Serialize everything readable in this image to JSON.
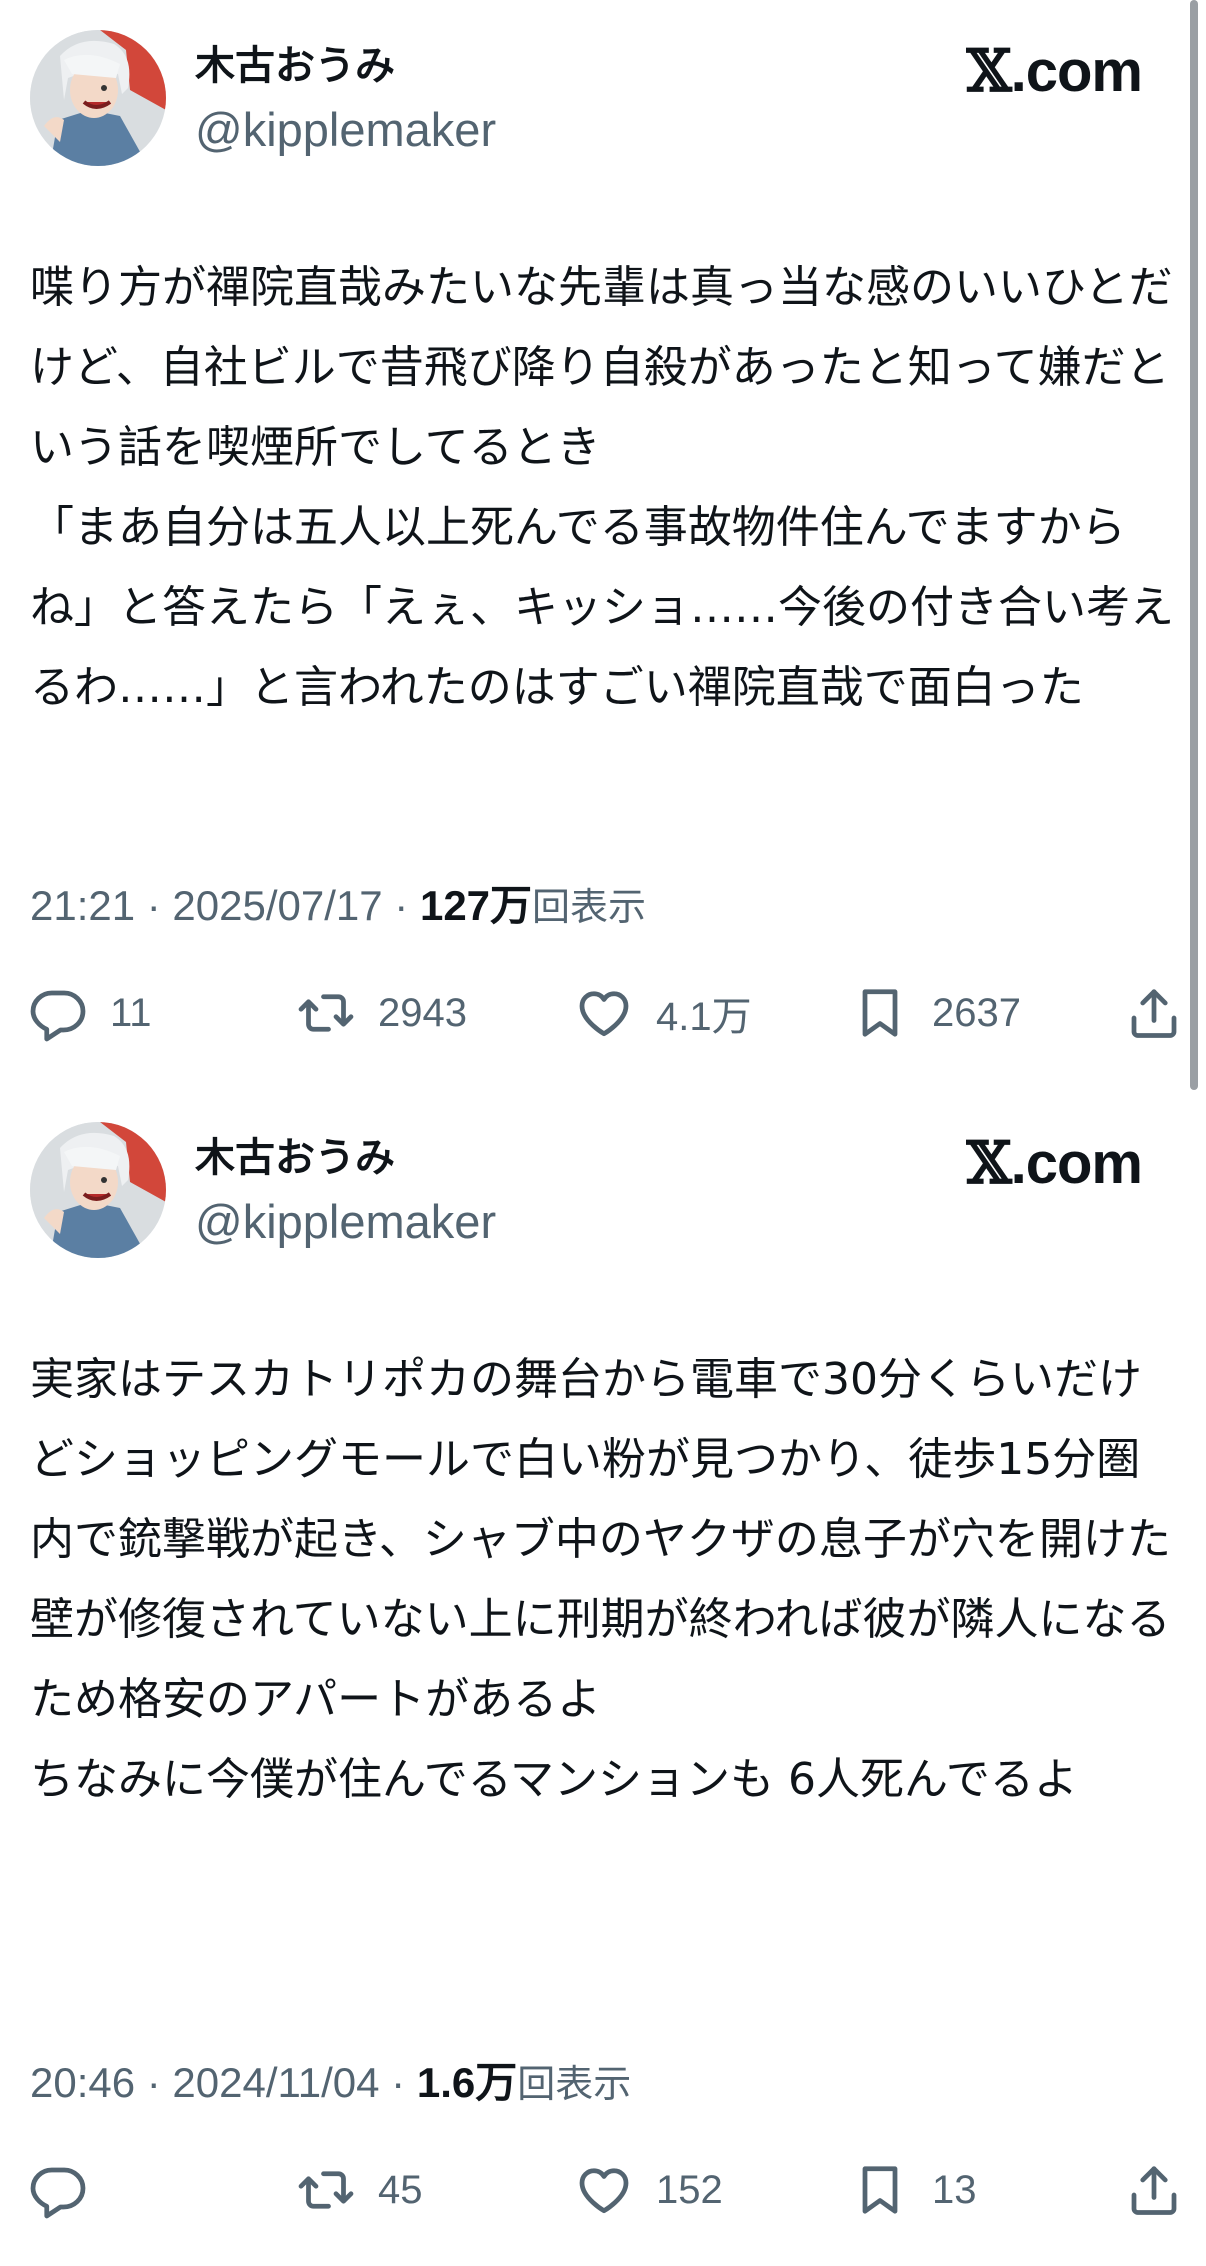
{
  "tweets": [
    {
      "author": {
        "display_name": "木古おうみ",
        "handle": "@kipplemaker"
      },
      "brand": ".com",
      "text": "喋り方が禪院直哉みたいな先輩は真っ当な感のいいひとだけど、自社ビルで昔飛び降り自殺があったと知って嫌だという話を喫煙所でしてるとき\n「まあ自分は五人以上死んでる事故物件住んでますからね」と答えたら「えぇ、キッショ……今後の付き合い考えるわ……」と言われたのはすごい禪院直哉で面白った",
      "timestamp": "21:21 · 2025/07/17 · ",
      "views_count": "127万",
      "views_label": "回表示",
      "actions": {
        "replies": "11",
        "reposts": "2943",
        "likes": "4.1万",
        "bookmarks": "2637"
      }
    },
    {
      "author": {
        "display_name": "木古おうみ",
        "handle": "@kipplemaker"
      },
      "brand": ".com",
      "text": "実家はテスカトリポカの舞台から電車で30分くらいだけどショッピングモールで白い粉が見つかり、徒歩15分圏内で銃撃戦が起き、シャブ中のヤクザの息子が穴を開けた壁が修復されていない上に刑期が終われば彼が隣人になるため格安のアパートがあるよ\nちなみに今僕が住んでるマンションも 6人死んでるよ",
      "timestamp": "20:46 · 2024/11/04 · ",
      "views_count": "1.6万",
      "views_label": "回表示",
      "actions": {
        "replies": "",
        "reposts": "45",
        "likes": "152",
        "bookmarks": "13"
      }
    }
  ],
  "icons": {
    "reply": "reply-icon",
    "repost": "repost-icon",
    "like": "heart-icon",
    "bookmark": "bookmark-icon",
    "share": "share-icon",
    "brand": "x-logo-icon"
  },
  "colors": {
    "text": "#0f1419",
    "secondary": "#536471",
    "background": "#ffffff"
  }
}
